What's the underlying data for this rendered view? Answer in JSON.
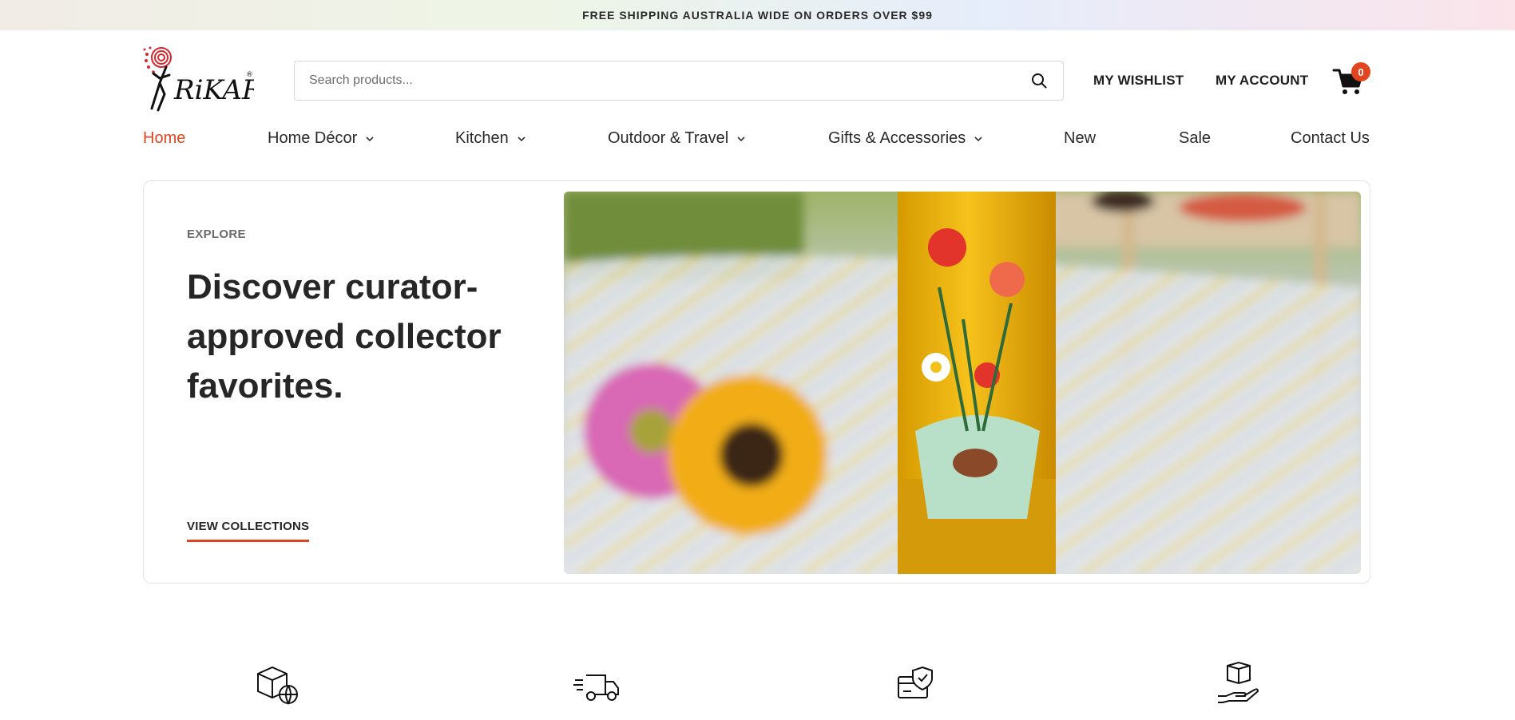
{
  "announcement": "FREE SHIPPING AUSTRALIA WIDE ON ORDERS OVER $99",
  "brand": {
    "logo_text": "RiKARO",
    "accent": "#e0451f"
  },
  "search": {
    "placeholder": "Search products..."
  },
  "header": {
    "wishlist": "MY WISHLIST",
    "account": "MY ACCOUNT",
    "cart_count": "0"
  },
  "nav": {
    "items": [
      {
        "label": "Home",
        "active": true
      },
      {
        "label": "Home Décor",
        "dropdown": true
      },
      {
        "label": "Kitchen",
        "dropdown": true
      },
      {
        "label": "Outdoor & Travel",
        "dropdown": true
      },
      {
        "label": "Gifts & Accessories",
        "dropdown": true
      },
      {
        "label": "New"
      },
      {
        "label": "Sale"
      },
      {
        "label": "Contact Us"
      }
    ]
  },
  "hero": {
    "eyebrow": "EXPLORE",
    "headline": "Discover curator-approved collector favorites.",
    "cta": "VIEW COLLECTIONS"
  },
  "features": {
    "icons": [
      "global-box-icon",
      "delivery-truck-icon",
      "secure-payment-icon",
      "hand-box-icon"
    ]
  }
}
